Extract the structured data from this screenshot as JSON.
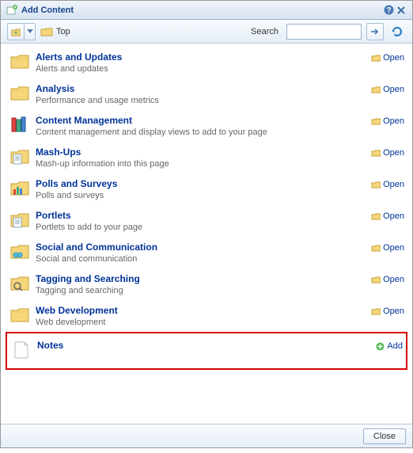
{
  "title": "Add Content",
  "breadcrumb": "Top",
  "search_label": "Search",
  "search_value": "",
  "open_label": "Open",
  "add_label": "Add",
  "close_label": "Close",
  "items": [
    {
      "title": "Alerts and Updates",
      "desc": "Alerts and updates",
      "icon": "folder",
      "action": "open"
    },
    {
      "title": "Analysis",
      "desc": "Performance and usage metrics",
      "icon": "folder",
      "action": "open"
    },
    {
      "title": "Content Management",
      "desc": "Content management and display views to add to your page",
      "icon": "books",
      "action": "open"
    },
    {
      "title": "Mash-Ups",
      "desc": "Mash-up information into this page",
      "icon": "folder-doc",
      "action": "open"
    },
    {
      "title": "Polls and Surveys",
      "desc": "Polls and surveys",
      "icon": "chart",
      "action": "open"
    },
    {
      "title": "Portlets",
      "desc": "Portlets to add to your page",
      "icon": "folder-doc",
      "action": "open"
    },
    {
      "title": "Social and Communication",
      "desc": "Social and communication",
      "icon": "folder-people",
      "action": "open"
    },
    {
      "title": "Tagging and Searching",
      "desc": "Tagging and searching",
      "icon": "folder-search",
      "action": "open"
    },
    {
      "title": "Web Development",
      "desc": "Web development",
      "icon": "folder",
      "action": "open"
    },
    {
      "title": "Notes",
      "desc": "",
      "icon": "page",
      "action": "add",
      "highlighted": true
    }
  ]
}
